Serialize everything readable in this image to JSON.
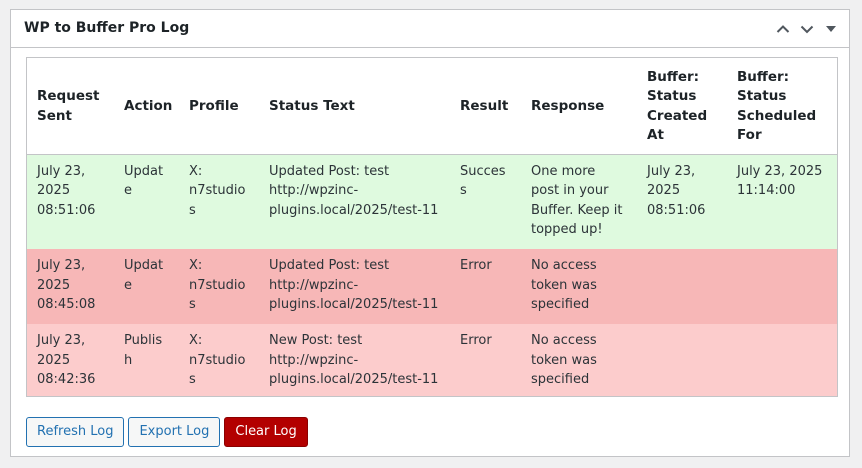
{
  "panel": {
    "title": "WP to Buffer Pro Log",
    "move_up_icon": "chevron-up-icon",
    "move_down_icon": "chevron-down-icon",
    "toggle_icon": "triangle-down-icon"
  },
  "table": {
    "columns": [
      "Request Sent",
      "Action",
      "Profile",
      "Status Text",
      "Result",
      "Response",
      "Buffer: Status Created At",
      "Buffer: Status Scheduled For"
    ],
    "rows": [
      {
        "status": "success",
        "request_sent": "July 23, 2025 08:51:06",
        "action": "Update",
        "profile": "X: n7studios",
        "status_text": "Updated Post: test http://wpzinc-plugins.local/2025/test-11",
        "result": "Success",
        "response": "One more post in your Buffer. Keep it topped up!",
        "created_at": "July 23, 2025 08:51:06",
        "scheduled_for": "July 23, 2025 11:14:00"
      },
      {
        "status": "error",
        "request_sent": "July 23, 2025 08:45:08",
        "action": "Update",
        "profile": "X: n7studios",
        "status_text": "Updated Post: test http://wpzinc-plugins.local/2025/test-11",
        "result": "Error",
        "response": "No access token was specified",
        "created_at": "",
        "scheduled_for": ""
      },
      {
        "status": "error",
        "request_sent": "July 23, 2025 08:42:36",
        "action": "Publish",
        "profile": "X: n7studios",
        "status_text": "New Post: test http://wpzinc-plugins.local/2025/test-11",
        "result": "Error",
        "response": "No access token was specified",
        "created_at": "",
        "scheduled_for": ""
      }
    ]
  },
  "buttons": {
    "refresh": "Refresh Log",
    "export": "Export Log",
    "clear": "Clear Log"
  },
  "colors": {
    "success_row": "#dffadf",
    "error_row_dark": "#f7b7b7",
    "error_row_light": "#fccccc",
    "primary_blue": "#2271b1",
    "danger_red": "#b30000"
  }
}
